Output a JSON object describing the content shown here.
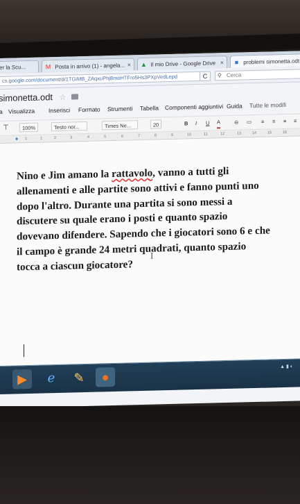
{
  "browser": {
    "tabs": [
      {
        "label": "er la Scu...",
        "icon": "",
        "active": false
      },
      {
        "label": "Posta in arrivo (1) - angela...",
        "icon": "gmail-icon",
        "active": false
      },
      {
        "label": "Il mio Drive - Google Drive",
        "icon": "drive-icon",
        "active": false
      },
      {
        "label": "problemi simonetta.odt -...",
        "icon": "docs-icon",
        "active": true
      }
    ],
    "close_glyph": "×",
    "url": "cs.google.com/document/d/1TGiMB_ZAqxuPhj8moHTFro5Hs3PXpVedLepd",
    "reload_glyph": "C",
    "search_placeholder": "Cerca"
  },
  "doc": {
    "title": "simonetta.odt",
    "star": "☆",
    "menu": [
      "a",
      "Visualizza",
      "Inserisci",
      "Formato",
      "Strumenti",
      "Tabella",
      "Componenti aggiuntivi",
      "Guida",
      "Tutte le modifi"
    ],
    "toolbar": {
      "zoom": "100%",
      "style": "Testo nor...",
      "font": "Times Ne...",
      "size": "20",
      "bold": "B",
      "italic": "I",
      "underline": "U",
      "text_color": "A",
      "link": "⊖"
    },
    "ruler_marks": [
      "1",
      "1",
      "2",
      "3",
      "4",
      "5",
      "6",
      "7",
      "8",
      "9",
      "10",
      "11",
      "12",
      "13",
      "14",
      "15",
      "16"
    ],
    "body_lines": [
      {
        "before": "Nino e Jim amano la ",
        "misspelled": "rattavolo",
        "after": ", vanno a tutti gli"
      },
      {
        "text": "allenamenti e alle partite sono attivi e fanno punti uno"
      },
      {
        "text": "dopo l'altro. Durante una partita si sono messi a"
      },
      {
        "text": "discutere su quale erano i posti e quanto spazio"
      },
      {
        "text": "dovevano difendere. Sapendo che i giocatori sono 6 e che"
      },
      {
        "text": "il campo è grande 24 metri quadrati, quanto spazio"
      },
      {
        "text": "tocca a ciascun giocatore?"
      }
    ],
    "cursor_glyph": "I"
  },
  "taskbar": {
    "buttons": [
      {
        "name": "media-player-icon",
        "glyph": "▶"
      },
      {
        "name": "internet-explorer-icon",
        "glyph": "e"
      },
      {
        "name": "file-manager-icon",
        "glyph": "✎"
      },
      {
        "name": "firefox-icon",
        "glyph": "●"
      }
    ]
  }
}
